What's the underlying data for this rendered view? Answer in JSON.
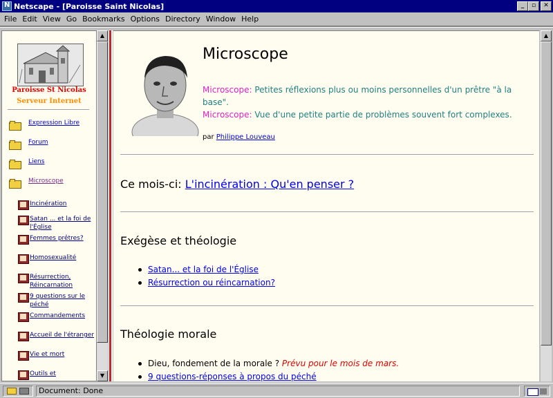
{
  "window": {
    "title": "Netscape - [Paroisse Saint Nicolas]",
    "buttons": {
      "minimize": "_",
      "maximize": "▫",
      "close": "✕"
    }
  },
  "menu": [
    "File",
    "Edit",
    "View",
    "Go",
    "Bookmarks",
    "Options",
    "Directory",
    "Window",
    "Help"
  ],
  "sidebar": {
    "parish_name": "Paroisse St Nicolas",
    "server_name": "Serveur Internet",
    "items": [
      {
        "label": "Expression Libre"
      },
      {
        "label": "Forum"
      },
      {
        "label": "Liens"
      },
      {
        "label": "Microscope"
      }
    ],
    "sub_items": [
      {
        "label": "Incinération"
      },
      {
        "label": "Satan ... et la foi de l'Église"
      },
      {
        "label": "Femmes prêtres?"
      },
      {
        "label": "Homosexualité"
      },
      {
        "label": "Résurrection, Réincarnation"
      },
      {
        "label": "9 questions sur le péché"
      },
      {
        "label": "Commandements"
      },
      {
        "label": "Accueil de l'étranger"
      },
      {
        "label": "Vie et mort"
      },
      {
        "label": "Outils et"
      }
    ]
  },
  "main": {
    "title": "Microscope",
    "desc1_word": "Microscope:",
    "desc1_text": " Petites réflexions plus ou moins personnelles d'un prêtre \"à la base\".",
    "desc2_word": "Microscope:",
    "desc2_text": " Vue d'une petite partie de problèmes souvent fort complexes.",
    "byline_prefix": "par ",
    "author": "Philippe Louveau",
    "month_prefix": "Ce mois-ci: ",
    "month_link": "L'incinération : Qu'en penser ?",
    "section1": {
      "title": "Exégèse et théologie",
      "links": [
        "Satan... et la foi de l'Église",
        "Résurrection ou réincarnation?"
      ]
    },
    "section2": {
      "title": "Théologie morale",
      "item1_text": "Dieu, fondement de la morale ? ",
      "item1_note": "Prévu pour le mois de mars.",
      "item2_link": "9 questions-réponses à propos du péché"
    }
  },
  "status": {
    "text": "Document: Done"
  },
  "colors": {
    "accent_title": "#000080",
    "divider": "#c02828",
    "highlight": "#e020c0",
    "teal": "#208080"
  }
}
